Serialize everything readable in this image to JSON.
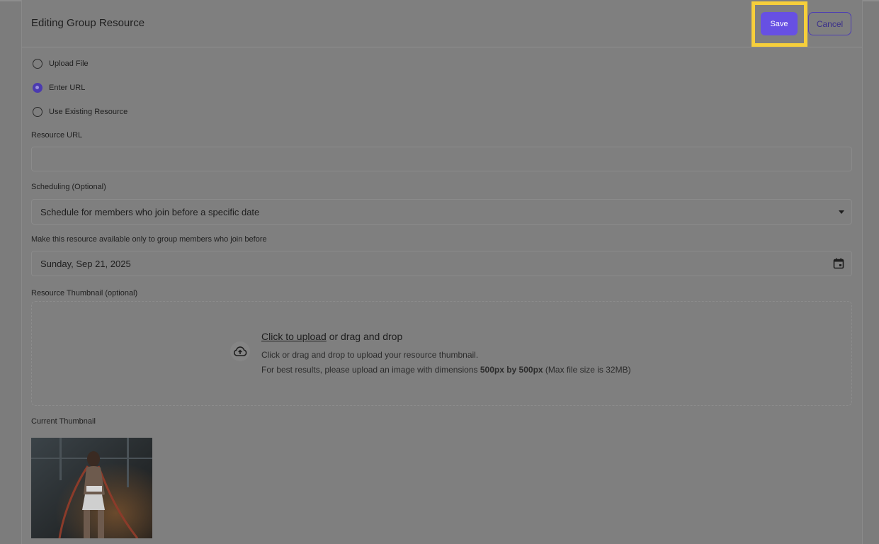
{
  "header": {
    "title": "Editing Group Resource",
    "save_label": "Save",
    "cancel_label": "Cancel"
  },
  "source_options": [
    {
      "label": "Upload File",
      "selected": false
    },
    {
      "label": "Enter URL",
      "selected": true
    },
    {
      "label": "Use Existing Resource",
      "selected": false
    }
  ],
  "resource_url": {
    "label": "Resource URL",
    "value": ""
  },
  "scheduling": {
    "label": "Scheduling (Optional)",
    "value": "Schedule for members who join before a specific date"
  },
  "join_before": {
    "label": "Make this resource available only to group members who join before",
    "value": "Sunday, Sep 21, 2025"
  },
  "thumbnail": {
    "label": "Resource Thumbnail (optional)",
    "link": "Click to upload",
    "title_rest": " or drag and drop",
    "hint1": "Click or drag and drop to upload your resource thumbnail.",
    "hint2_pre": "For best results, please upload an image with dimensions ",
    "hint2_bold": "500px by 500px",
    "hint2_post": " (Max file size is 32MB)"
  },
  "current_thumbnail": {
    "label": "Current Thumbnail"
  },
  "colors": {
    "accent": "#6750e3",
    "highlight": "#f6cf3b"
  }
}
